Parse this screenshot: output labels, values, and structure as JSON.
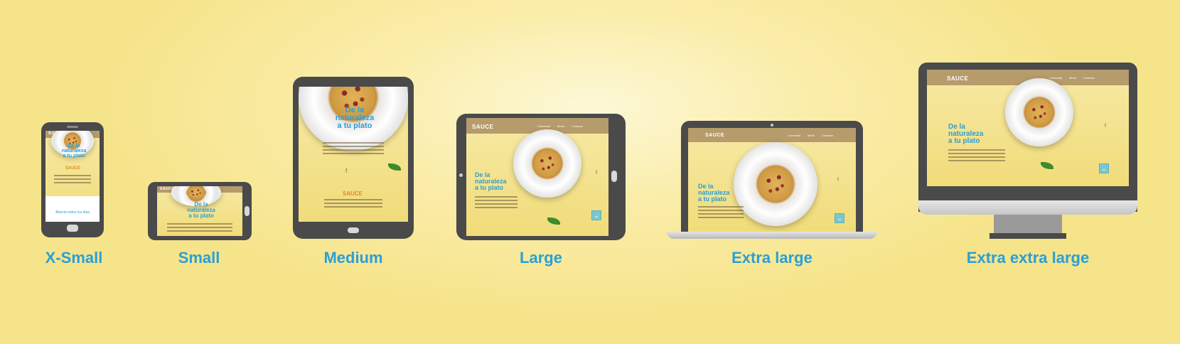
{
  "devices": [
    {
      "key": "xsmall",
      "label": "X-Small"
    },
    {
      "key": "small",
      "label": "Small"
    },
    {
      "key": "medium",
      "label": "Medium"
    },
    {
      "key": "large",
      "label": "Large"
    },
    {
      "key": "xlarge",
      "label": "Extra large"
    },
    {
      "key": "xxlarge",
      "label": "Extra extra large"
    }
  ],
  "site": {
    "brand": "SAUCE",
    "headline_line1": "De la",
    "headline_line2": "naturaleza",
    "headline_line3": "a tu plato",
    "nav": [
      "Comercial",
      "Menú",
      "Contacto"
    ],
    "sub_brand": "SAUCE",
    "open_text": "Abierto todos los días",
    "facebook_icon": "f",
    "arrow_icon": "⌄"
  },
  "colors": {
    "accent_blue": "#2a9fd6",
    "device_frame": "#4a4a4a",
    "screen_yellow": "#f3e28f",
    "arrow_teal": "#7cc6cf"
  }
}
